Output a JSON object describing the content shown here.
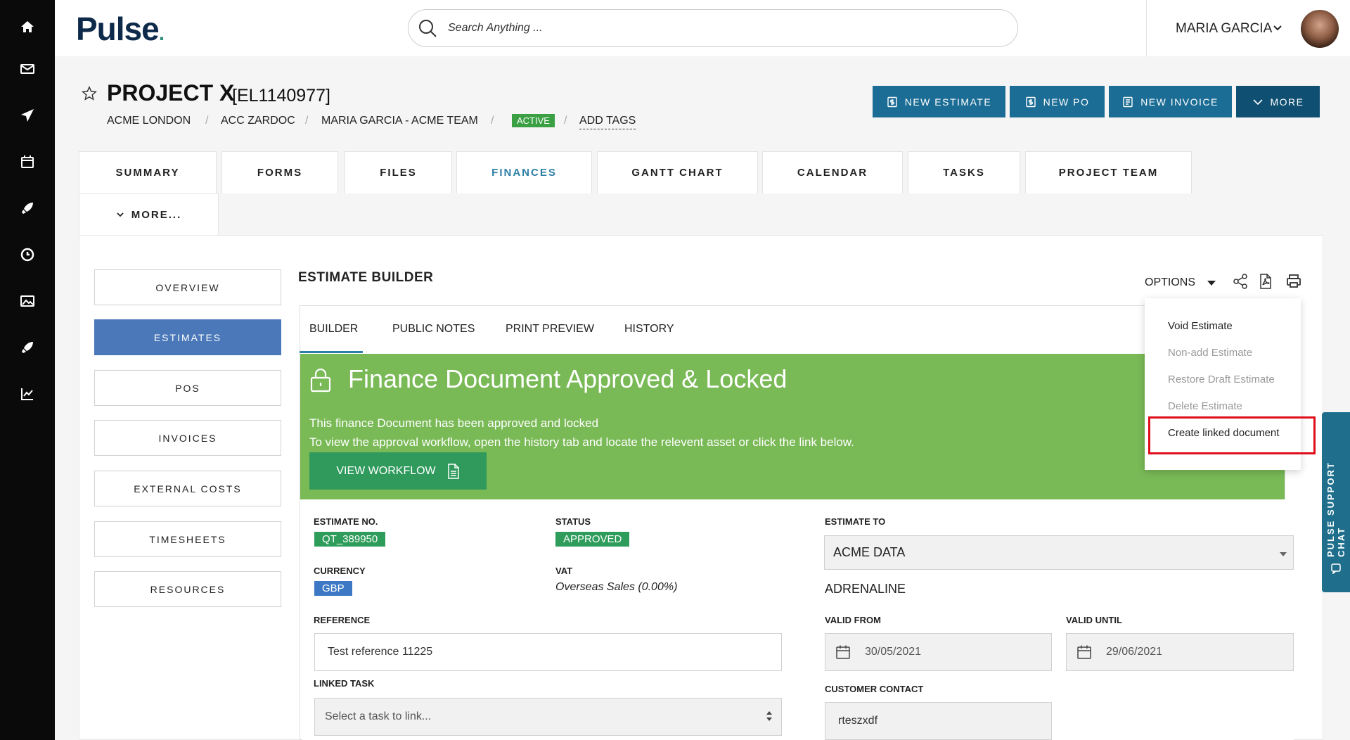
{
  "rail": {
    "items": [
      {
        "icon": "home-icon"
      },
      {
        "icon": "mail-icon"
      },
      {
        "icon": "paper-plane-icon"
      },
      {
        "icon": "calendar-icon"
      },
      {
        "icon": "rocket-icon"
      },
      {
        "icon": "clock-icon"
      },
      {
        "icon": "image-icon"
      },
      {
        "icon": "rocket-icon"
      },
      {
        "icon": "chart-icon"
      }
    ]
  },
  "header": {
    "logo": "Pulse",
    "search_placeholder": "Search Anything ...",
    "user_name": "MARIA GARCIA"
  },
  "project": {
    "title": "PROJECT X",
    "code": "[EL1140977]",
    "breadcrumbs": [
      "ACME LONDON",
      "ACC ZARDOC",
      "MARIA GARCIA - ACME TEAM"
    ],
    "separator": "/",
    "status": "ACTIVE",
    "add_tags": "ADD TAGS"
  },
  "actions": {
    "new_estimate": "NEW ESTIMATE",
    "new_po": "NEW PO",
    "new_invoice": "NEW INVOICE",
    "more": "MORE"
  },
  "tabs": [
    {
      "label": "SUMMARY"
    },
    {
      "label": "FORMS"
    },
    {
      "label": "FILES"
    },
    {
      "label": "FINANCES"
    },
    {
      "label": "GANTT CHART"
    },
    {
      "label": "CALENDAR"
    },
    {
      "label": "TASKS"
    },
    {
      "label": "PROJECT TEAM"
    },
    {
      "label": "MORE..."
    }
  ],
  "sidebar": {
    "items": [
      {
        "label": "OVERVIEW"
      },
      {
        "label": "ESTIMATES"
      },
      {
        "label": "POS"
      },
      {
        "label": "INVOICES"
      },
      {
        "label": "EXTERNAL COSTS"
      },
      {
        "label": "TIMESHEETS"
      },
      {
        "label": "RESOURCES"
      }
    ]
  },
  "estimate": {
    "title": "ESTIMATE BUILDER",
    "options_label": "OPTIONS",
    "builder_tabs": [
      "BUILDER",
      "PUBLIC NOTES",
      "PRINT PREVIEW",
      "HISTORY"
    ],
    "banner": {
      "title": "Finance Document Approved & Locked",
      "line1": "This finance Document has been approved and locked",
      "line2": "To view the approval workflow, open the history tab and locate the relevent asset or click the link below.",
      "button": "VIEW WORKFLOW"
    },
    "form": {
      "estimate_no_label": "ESTIMATE NO.",
      "estimate_no": "QT_389950",
      "status_label": "STATUS",
      "status": "APPROVED",
      "currency_label": "CURRENCY",
      "currency": "GBP",
      "vat_label": "VAT",
      "vat": "Overseas Sales (0.00%)",
      "reference_label": "REFERENCE",
      "reference": "Test reference 11225",
      "linked_task_label": "LINKED TASK",
      "linked_task_placeholder": "Select a task to link...",
      "estimate_to_label": "ESTIMATE TO",
      "estimate_to": "ACME DATA",
      "estimate_to_sub": "ADRENALINE",
      "valid_from_label": "VALID FROM",
      "valid_from": "30/05/2021",
      "valid_until_label": "VALID UNTIL",
      "valid_until": "29/06/2021",
      "customer_contact_label": "CUSTOMER CONTACT",
      "customer_contact": "rteszxdf"
    }
  },
  "options_menu": {
    "items": [
      {
        "label": "Void Estimate",
        "enabled": true
      },
      {
        "label": "Non-add Estimate",
        "enabled": false
      },
      {
        "label": "Restore Draft Estimate",
        "enabled": false
      },
      {
        "label": "Delete Estimate",
        "enabled": false
      },
      {
        "label": "Create linked document",
        "enabled": true,
        "highlighted": true
      }
    ]
  },
  "support_chat": {
    "label": "PULSE SUPPORT CHAT"
  },
  "colors": {
    "primary_button": "#1c6d95",
    "banner_green": "#79b956",
    "active_sidebar": "#4a78b8",
    "active_badge": "#3aa043",
    "highlight_red": "#e00d1a"
  }
}
